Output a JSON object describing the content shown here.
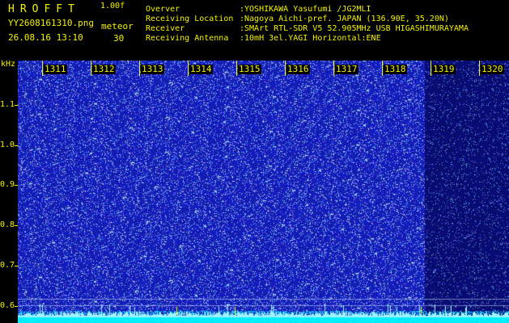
{
  "header": {
    "logo": "HROFFT",
    "version": "1.00f",
    "filename": "YY2608161310.png",
    "mode": "meteor",
    "datetime": "26.08.16 13:10",
    "count": "30",
    "fields": [
      {
        "label": "Overver",
        "value": ":YOSHIKAWA Yasufumi /JG2MLI"
      },
      {
        "label": "Receiving Location",
        "value": ":Nagoya Aichi-pref. JAPAN (136.90E, 35.20N)"
      },
      {
        "label": "Receiver",
        "value": ":SMArt RTL-SDR V5 52.905MHz USB HIGASHIMURAYAMA"
      },
      {
        "label": "Receiving Antenna",
        "value": ":10mH 3el.YAGI Horizontal:ENE"
      }
    ]
  },
  "y_axis": {
    "unit": "kHz",
    "ticks": [
      "1.1",
      "1.0",
      "0.9",
      "0.8",
      "0.7",
      "0.6"
    ]
  },
  "x_axis": {
    "ticks": [
      "1311",
      "1312",
      "1313",
      "1314",
      "1315",
      "1316",
      "1317",
      "1318",
      "1319",
      "1320"
    ]
  },
  "colors": {
    "text": "#f2f200",
    "background": "#000000",
    "waterfall_base": "#0a14c8",
    "waterfall_dim": "#0a0e7a",
    "noise_floor": "#00e5ff"
  }
}
